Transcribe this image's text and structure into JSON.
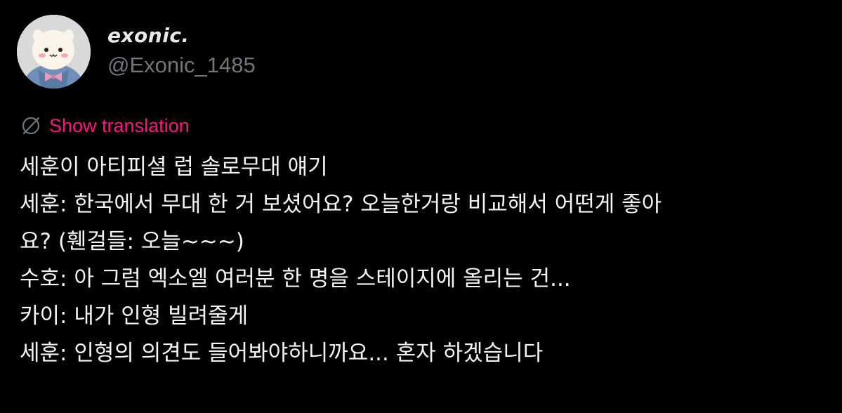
{
  "user": {
    "display_name": "exonic.",
    "handle": "@Exonic_1485"
  },
  "translation": {
    "label": "Show translation",
    "icon": "globe-slash-icon",
    "accent_color": "#f91880"
  },
  "tweet": {
    "lines": [
      "세훈이 아티피셜 럽 솔로무대 얘기",
      "세훈: 한국에서 무대 한 거 보셨어요? 오늘한거랑 비교해서 어떤게 좋아",
      "요? (휀걸들: 오늘~~~)",
      "수호: 아 그럼 엑소엘 여러분 한 명을 스테이지에 올리는 건...",
      "카이: 내가 인형 빌려줄게",
      "세훈: 인형의 의견도 들어봐야하니까요... 혼자 하겠습니다"
    ]
  }
}
